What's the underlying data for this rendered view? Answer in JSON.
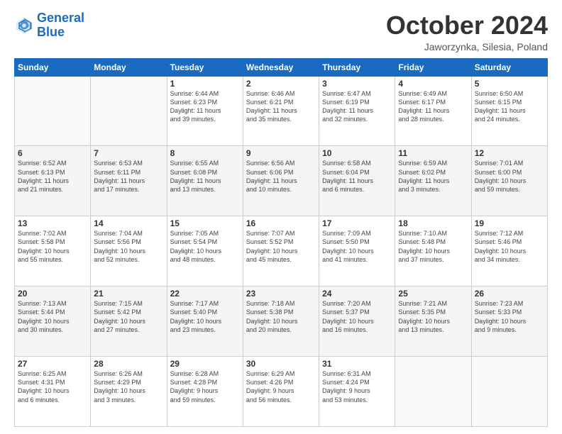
{
  "logo": {
    "line1": "General",
    "line2": "Blue"
  },
  "header": {
    "title": "October 2024",
    "location": "Jaworzynka, Silesia, Poland"
  },
  "weekdays": [
    "Sunday",
    "Monday",
    "Tuesday",
    "Wednesday",
    "Thursday",
    "Friday",
    "Saturday"
  ],
  "weeks": [
    [
      {
        "day": "",
        "info": ""
      },
      {
        "day": "",
        "info": ""
      },
      {
        "day": "1",
        "info": "Sunrise: 6:44 AM\nSunset: 6:23 PM\nDaylight: 11 hours\nand 39 minutes."
      },
      {
        "day": "2",
        "info": "Sunrise: 6:46 AM\nSunset: 6:21 PM\nDaylight: 11 hours\nand 35 minutes."
      },
      {
        "day": "3",
        "info": "Sunrise: 6:47 AM\nSunset: 6:19 PM\nDaylight: 11 hours\nand 32 minutes."
      },
      {
        "day": "4",
        "info": "Sunrise: 6:49 AM\nSunset: 6:17 PM\nDaylight: 11 hours\nand 28 minutes."
      },
      {
        "day": "5",
        "info": "Sunrise: 6:50 AM\nSunset: 6:15 PM\nDaylight: 11 hours\nand 24 minutes."
      }
    ],
    [
      {
        "day": "6",
        "info": "Sunrise: 6:52 AM\nSunset: 6:13 PM\nDaylight: 11 hours\nand 21 minutes."
      },
      {
        "day": "7",
        "info": "Sunrise: 6:53 AM\nSunset: 6:11 PM\nDaylight: 11 hours\nand 17 minutes."
      },
      {
        "day": "8",
        "info": "Sunrise: 6:55 AM\nSunset: 6:08 PM\nDaylight: 11 hours\nand 13 minutes."
      },
      {
        "day": "9",
        "info": "Sunrise: 6:56 AM\nSunset: 6:06 PM\nDaylight: 11 hours\nand 10 minutes."
      },
      {
        "day": "10",
        "info": "Sunrise: 6:58 AM\nSunset: 6:04 PM\nDaylight: 11 hours\nand 6 minutes."
      },
      {
        "day": "11",
        "info": "Sunrise: 6:59 AM\nSunset: 6:02 PM\nDaylight: 11 hours\nand 3 minutes."
      },
      {
        "day": "12",
        "info": "Sunrise: 7:01 AM\nSunset: 6:00 PM\nDaylight: 10 hours\nand 59 minutes."
      }
    ],
    [
      {
        "day": "13",
        "info": "Sunrise: 7:02 AM\nSunset: 5:58 PM\nDaylight: 10 hours\nand 55 minutes."
      },
      {
        "day": "14",
        "info": "Sunrise: 7:04 AM\nSunset: 5:56 PM\nDaylight: 10 hours\nand 52 minutes."
      },
      {
        "day": "15",
        "info": "Sunrise: 7:05 AM\nSunset: 5:54 PM\nDaylight: 10 hours\nand 48 minutes."
      },
      {
        "day": "16",
        "info": "Sunrise: 7:07 AM\nSunset: 5:52 PM\nDaylight: 10 hours\nand 45 minutes."
      },
      {
        "day": "17",
        "info": "Sunrise: 7:09 AM\nSunset: 5:50 PM\nDaylight: 10 hours\nand 41 minutes."
      },
      {
        "day": "18",
        "info": "Sunrise: 7:10 AM\nSunset: 5:48 PM\nDaylight: 10 hours\nand 37 minutes."
      },
      {
        "day": "19",
        "info": "Sunrise: 7:12 AM\nSunset: 5:46 PM\nDaylight: 10 hours\nand 34 minutes."
      }
    ],
    [
      {
        "day": "20",
        "info": "Sunrise: 7:13 AM\nSunset: 5:44 PM\nDaylight: 10 hours\nand 30 minutes."
      },
      {
        "day": "21",
        "info": "Sunrise: 7:15 AM\nSunset: 5:42 PM\nDaylight: 10 hours\nand 27 minutes."
      },
      {
        "day": "22",
        "info": "Sunrise: 7:17 AM\nSunset: 5:40 PM\nDaylight: 10 hours\nand 23 minutes."
      },
      {
        "day": "23",
        "info": "Sunrise: 7:18 AM\nSunset: 5:38 PM\nDaylight: 10 hours\nand 20 minutes."
      },
      {
        "day": "24",
        "info": "Sunrise: 7:20 AM\nSunset: 5:37 PM\nDaylight: 10 hours\nand 16 minutes."
      },
      {
        "day": "25",
        "info": "Sunrise: 7:21 AM\nSunset: 5:35 PM\nDaylight: 10 hours\nand 13 minutes."
      },
      {
        "day": "26",
        "info": "Sunrise: 7:23 AM\nSunset: 5:33 PM\nDaylight: 10 hours\nand 9 minutes."
      }
    ],
    [
      {
        "day": "27",
        "info": "Sunrise: 6:25 AM\nSunset: 4:31 PM\nDaylight: 10 hours\nand 6 minutes."
      },
      {
        "day": "28",
        "info": "Sunrise: 6:26 AM\nSunset: 4:29 PM\nDaylight: 10 hours\nand 3 minutes."
      },
      {
        "day": "29",
        "info": "Sunrise: 6:28 AM\nSunset: 4:28 PM\nDaylight: 9 hours\nand 59 minutes."
      },
      {
        "day": "30",
        "info": "Sunrise: 6:29 AM\nSunset: 4:26 PM\nDaylight: 9 hours\nand 56 minutes."
      },
      {
        "day": "31",
        "info": "Sunrise: 6:31 AM\nSunset: 4:24 PM\nDaylight: 9 hours\nand 53 minutes."
      },
      {
        "day": "",
        "info": ""
      },
      {
        "day": "",
        "info": ""
      }
    ]
  ]
}
